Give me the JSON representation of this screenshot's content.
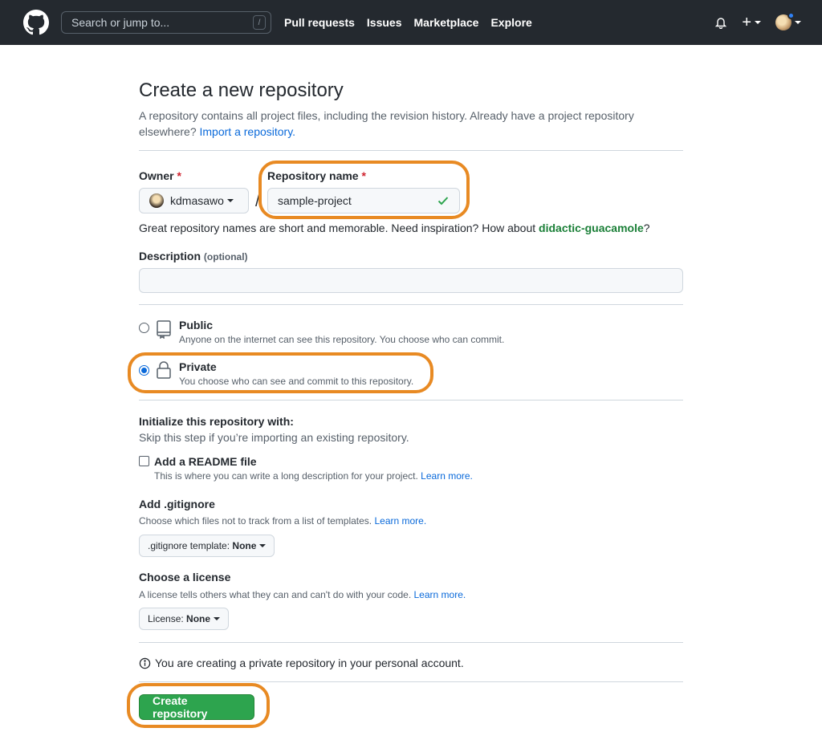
{
  "header": {
    "search_placeholder": "Search or jump to...",
    "search_shortcut": "/",
    "nav": [
      "Pull requests",
      "Issues",
      "Marketplace",
      "Explore"
    ],
    "plus_label": "+"
  },
  "page": {
    "title": "Create a new repository",
    "subtitle_text": "A repository contains all project files, including the revision history. Already have a project repository elsewhere?",
    "import_link": "Import a repository.",
    "owner_label": "Owner",
    "required_mark": "*",
    "owner_value": "kdmasawo",
    "separator": "/",
    "repo_name_label": "Repository name",
    "repo_name_value": "sample-project",
    "hint_text": "Great repository names are short and memorable. Need inspiration? How about",
    "hint_suggestion": "didactic-guacamole",
    "hint_end": "?",
    "description_label": "Description",
    "description_optional": "(optional)",
    "description_value": ""
  },
  "visibility": {
    "public_label": "Public",
    "public_desc": "Anyone on the internet can see this repository. You choose who can commit.",
    "private_label": "Private",
    "private_desc": "You choose who can see and commit to this repository.",
    "selected": "Private"
  },
  "init": {
    "title": "Initialize this repository with:",
    "subtitle": "Skip this step if you’re importing an existing repository.",
    "readme_label": "Add a README file",
    "readme_desc": "This is where you can write a long description for your project.",
    "readme_checked": false,
    "learn_more": "Learn more.",
    "gitignore_title": "Add .gitignore",
    "gitignore_desc": "Choose which files not to track from a list of templates.",
    "gitignore_button_prefix": ".gitignore template:",
    "gitignore_button_value": "None",
    "license_title": "Choose a license",
    "license_desc": "A license tells others what they can and can't do with your code.",
    "license_button_prefix": "License:",
    "license_button_value": "None"
  },
  "footer": {
    "info_text": "You are creating a private repository in your personal account.",
    "create_button": "Create repository"
  },
  "colors": {
    "header_bg": "#24292f",
    "accent_highlight": "#e88a23",
    "primary_button": "#2da44e",
    "link": "#0969da"
  }
}
